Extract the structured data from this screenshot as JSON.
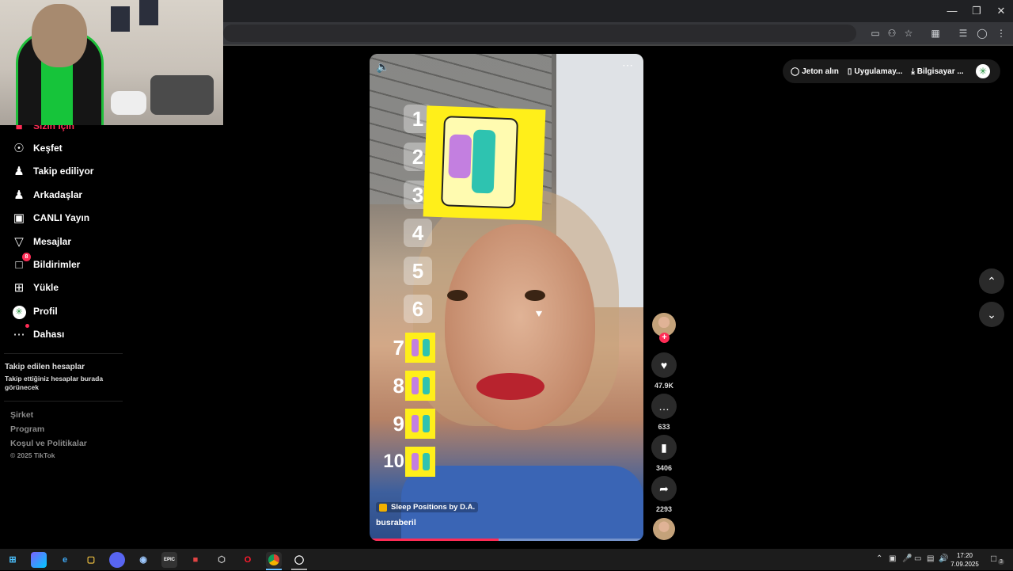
{
  "sidebar": {
    "items": [
      {
        "label": "Sizin İçin",
        "icon": "home-icon"
      },
      {
        "label": "Keşfet",
        "icon": "compass-icon"
      },
      {
        "label": "Takip ediliyor",
        "icon": "user-follow-icon"
      },
      {
        "label": "Arkadaşlar",
        "icon": "friends-icon"
      },
      {
        "label": "CANLI Yayın",
        "icon": "live-icon"
      },
      {
        "label": "Mesajlar",
        "icon": "send-icon"
      },
      {
        "label": "Bildirimler",
        "icon": "inbox-icon",
        "badge": "8"
      },
      {
        "label": "Yükle",
        "icon": "upload-icon"
      },
      {
        "label": "Profil",
        "icon": "profile-avatar-icon"
      },
      {
        "label": "Dahası",
        "icon": "more-dots-icon"
      }
    ],
    "following_heading": "Takip edilen hesaplar",
    "following_note": "Takip ettiğiniz hesaplar burada görünecek",
    "footer": {
      "company": "Şirket",
      "program": "Program",
      "terms": "Koşul ve Politikalar",
      "copyright": "© 2025 TikTok"
    }
  },
  "video": {
    "effect_name": "Sleep Positions by D.A.",
    "username": "busraberil",
    "ranks": [
      "1",
      "2",
      "3",
      "4",
      "5",
      "6",
      "7",
      "8",
      "9",
      "10"
    ],
    "progress": 0.47
  },
  "actions": {
    "likes": "47.9K",
    "comments": "633",
    "saves": "3406",
    "shares": "2293"
  },
  "topbar": {
    "coins": "Jeton alın",
    "app": "Uygulamay...",
    "computer": "Bilgisayar ..."
  },
  "taskbar": {
    "time": "17:20",
    "date": "7.09.2025",
    "notif_count": "3"
  },
  "colors": {
    "accent": "#fe2c55",
    "background": "#000000",
    "poster_yellow": "#ffef1a"
  }
}
